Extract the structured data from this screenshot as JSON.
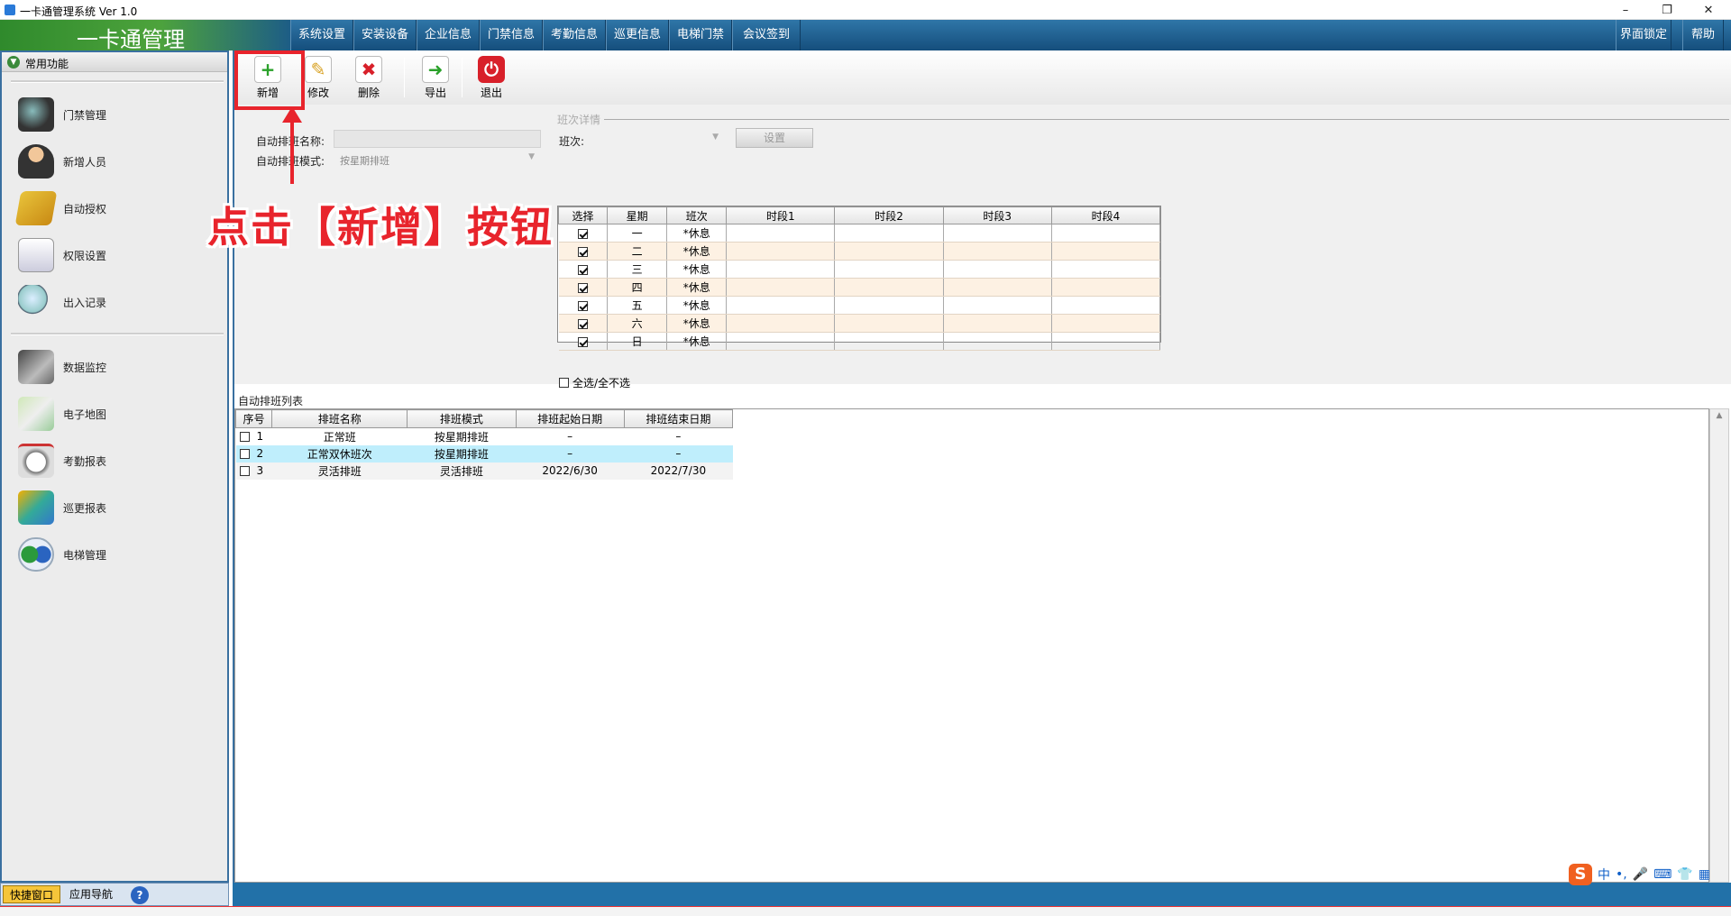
{
  "window": {
    "title": "一卡通管理系统  Ver 1.0",
    "minimize": "–",
    "restore": "❐",
    "close": "✕"
  },
  "header": {
    "logo": "一卡通管理",
    "menu": [
      "系统设置",
      "安装设备",
      "企业信息",
      "门禁信息",
      "考勤信息",
      "巡更信息",
      "电梯门禁",
      "会议签到"
    ],
    "right_menu": [
      "界面锁定",
      "帮助"
    ]
  },
  "sidebar": {
    "title": "常用功能",
    "group1": [
      "门禁管理",
      "新增人员",
      "自动授权",
      "权限设置",
      "出入记录"
    ],
    "group2": [
      "数据监控",
      "电子地图",
      "考勤报表",
      "巡更报表",
      "电梯管理"
    ],
    "tabs": [
      "快捷窗口",
      "应用导航",
      "?"
    ]
  },
  "toolbar": {
    "add": "新增",
    "edit": "修改",
    "delete": "删除",
    "export": "导出",
    "exit": "退出"
  },
  "form": {
    "name_label": "自动排班名称:",
    "name_value": "",
    "mode_label": "自动排班模式:",
    "mode_value": "按星期排班",
    "detail_legend": "班次详情",
    "shift_label": "班次:",
    "shift_value": "",
    "set_button": "设置",
    "select_all": "全选/全不选"
  },
  "week_grid": {
    "headers": [
      "选择",
      "星期",
      "班次",
      "时段1",
      "时段2",
      "时段3",
      "时段4"
    ],
    "rows": [
      {
        "checked": true,
        "day": "一",
        "shift": "*休息"
      },
      {
        "checked": true,
        "day": "二",
        "shift": "*休息"
      },
      {
        "checked": true,
        "day": "三",
        "shift": "*休息"
      },
      {
        "checked": true,
        "day": "四",
        "shift": "*休息"
      },
      {
        "checked": true,
        "day": "五",
        "shift": "*休息"
      },
      {
        "checked": true,
        "day": "六",
        "shift": "*休息"
      },
      {
        "checked": true,
        "day": "日",
        "shift": "*休息"
      }
    ]
  },
  "list": {
    "title": "自动排班列表",
    "headers": [
      "序号",
      "排班名称",
      "排班模式",
      "排班起始日期",
      "排班结束日期"
    ],
    "rows": [
      {
        "no": "1",
        "name": "正常班",
        "mode": "按星期排班",
        "start": "–",
        "end": "–"
      },
      {
        "no": "2",
        "name": "正常双休班次",
        "mode": "按星期排班",
        "start": "–",
        "end": "–"
      },
      {
        "no": "3",
        "name": "灵活排班",
        "mode": "灵活排班",
        "start": "2022/6/30",
        "end": "2022/7/30"
      }
    ],
    "selected_row": 2
  },
  "annotation": {
    "text": "点击【新增】按钮",
    "color": "#e8242c"
  },
  "ime": {
    "logo": "S",
    "mode": "中",
    "punct": "•,",
    "mic": "🎤",
    "kb": "⌨",
    "shirt": "👕",
    "grid": "▦"
  },
  "colors": {
    "header": "#1d5d86",
    "accent_red": "#e8242c",
    "selected_row": "#bfeefc"
  }
}
